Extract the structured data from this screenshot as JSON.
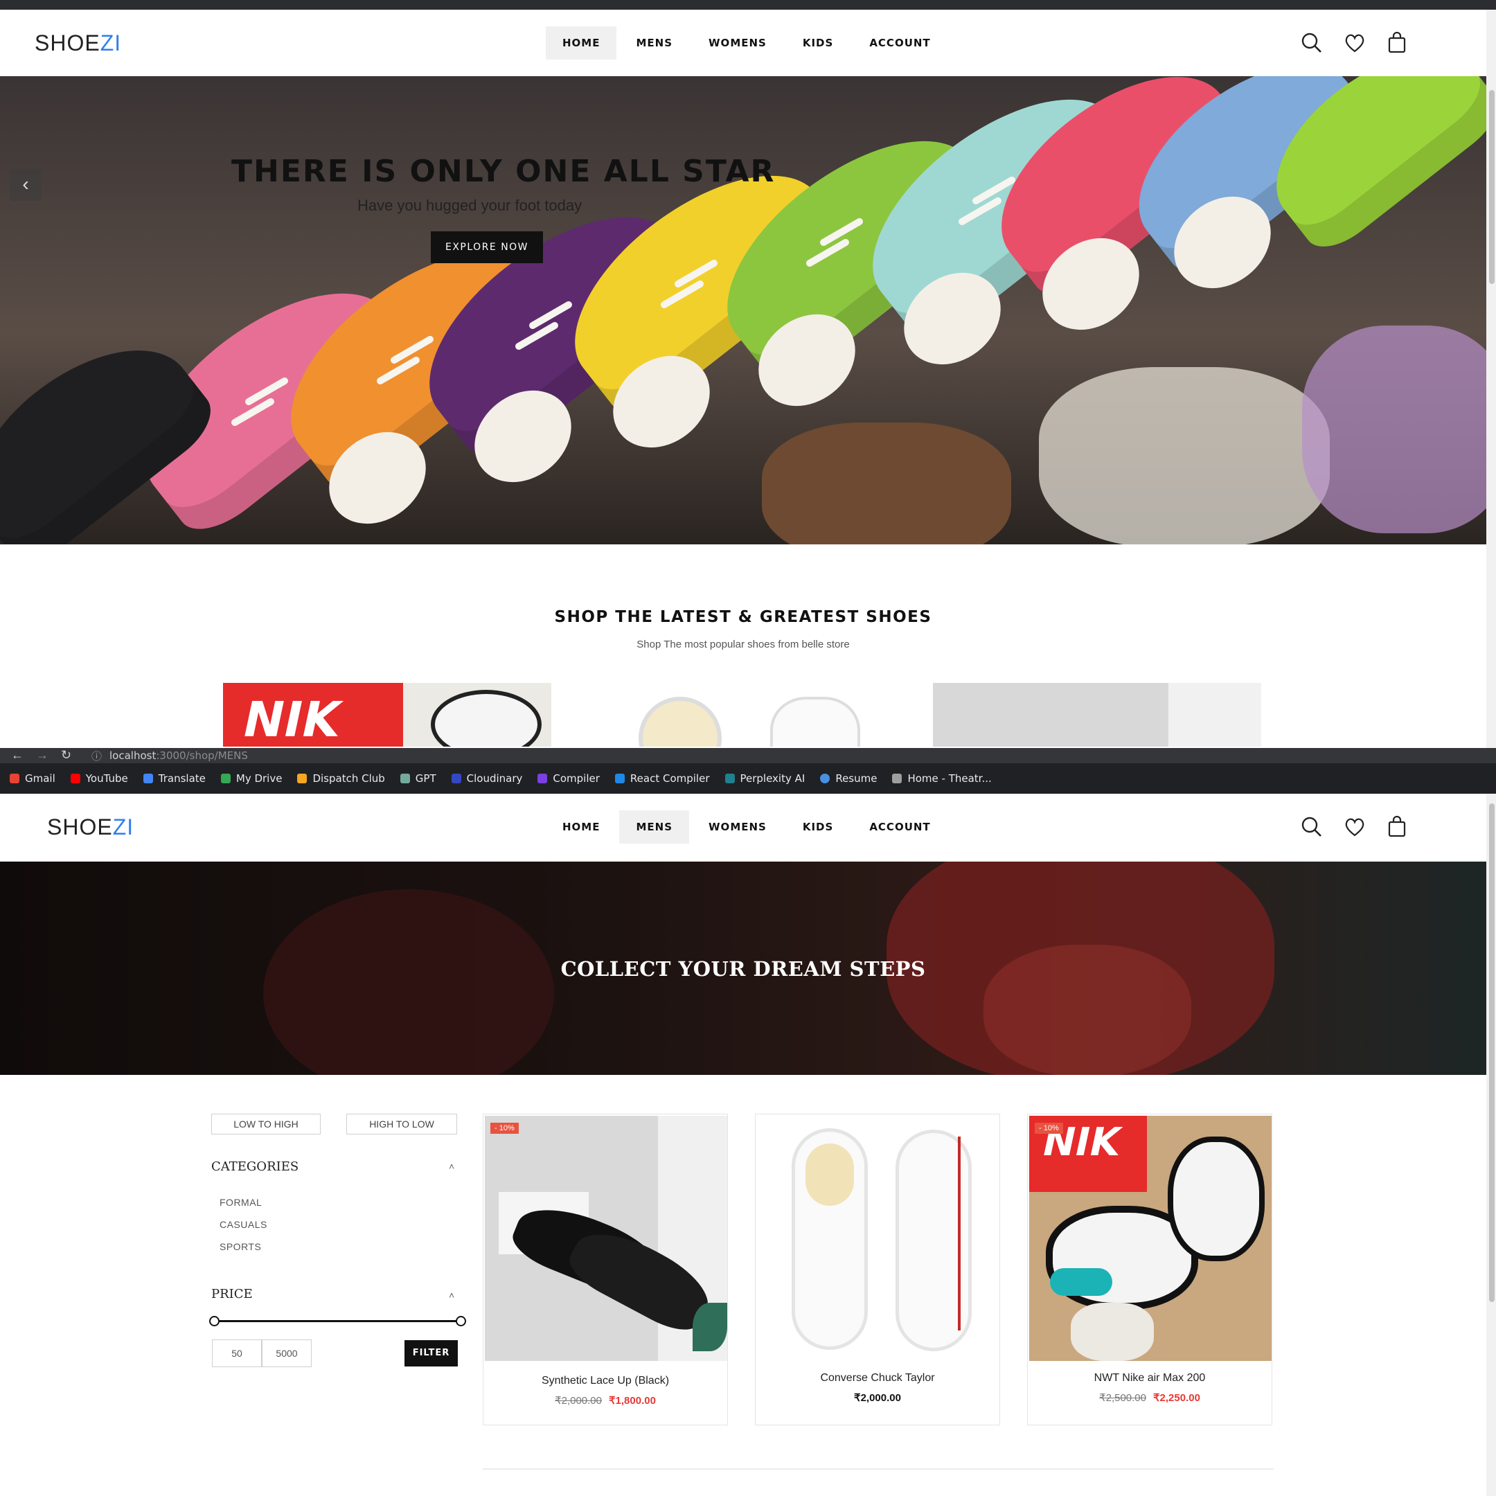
{
  "brand": {
    "name_main": "SHOE",
    "name_accent": "ZI",
    "accent_color": "#2f80ed"
  },
  "nav": {
    "items": [
      {
        "label": "HOME"
      },
      {
        "label": "MENS"
      },
      {
        "label": "WOMENS"
      },
      {
        "label": "KIDS"
      },
      {
        "label": "ACCOUNT"
      }
    ],
    "active_top": "HOME",
    "active_bottom": "MENS"
  },
  "header_icons": [
    "search-icon",
    "heart-icon",
    "shopping-bag-icon"
  ],
  "home_page": {
    "hero": {
      "title": "THERE IS ONLY ONE ALL STAR",
      "subtitle": "Have you hugged your foot today",
      "cta_label": "EXPLORE NOW"
    },
    "section": {
      "title": "SHOP THE LATEST & GREATEST SHOES",
      "subtitle": "Shop The most popular shoes from belle store"
    }
  },
  "browser": {
    "url_host": "localhost",
    "url_path": ":3000/shop/MENS",
    "bookmarks": [
      {
        "label": "Gmail",
        "color": "#ea4335"
      },
      {
        "label": "YouTube",
        "color": "#ff0000"
      },
      {
        "label": "Translate",
        "color": "#4285f4"
      },
      {
        "label": "My Drive",
        "color": "#34a853"
      },
      {
        "label": "Dispatch Club",
        "color": "#f5a623"
      },
      {
        "label": "GPT",
        "color": "#74aa9c"
      },
      {
        "label": "Cloudinary",
        "color": "#3448c5"
      },
      {
        "label": "Compiler",
        "color": "#7b3fe4"
      },
      {
        "label": "React Compiler",
        "color": "#1e88e5"
      },
      {
        "label": "Perplexity AI",
        "color": "#20808d"
      },
      {
        "label": "Resume",
        "color": "#4a90e2"
      },
      {
        "label": "Home - Theatr...",
        "color": "#9e9e9e"
      }
    ]
  },
  "shop_page": {
    "hero_title": "COLLECT YOUR DREAM STEPS",
    "sort": {
      "low_to_high": "LOW TO HIGH",
      "high_to_low": "HIGH TO LOW"
    },
    "categories": {
      "heading": "CATEGORIES",
      "items": [
        "FORMAL",
        "CASUALS",
        "SPORTS"
      ]
    },
    "price": {
      "heading": "PRICE",
      "min": "50",
      "max": "5000",
      "filter_label": "FILTER"
    },
    "products": [
      {
        "name": "Synthetic Lace Up (Black)",
        "old_price": "₹2,000.00",
        "price": "₹1,800.00",
        "badge": "- 10%"
      },
      {
        "name": "Converse Chuck Taylor",
        "old_price": "",
        "price": "₹2,000.00",
        "badge": ""
      },
      {
        "name": "NWT Nike air Max 200",
        "old_price": "₹2,500.00",
        "price": "₹2,250.00",
        "badge": "- 10%"
      }
    ]
  }
}
